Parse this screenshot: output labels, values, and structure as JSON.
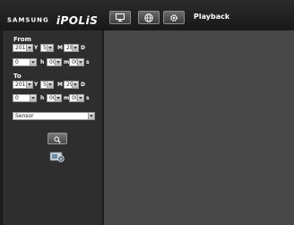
{
  "brand": {
    "company": "SAMSUNG",
    "product": "iPOLiS"
  },
  "header": {
    "buttons": [
      {
        "icon": "monitor-icon"
      },
      {
        "icon": "globe-icon"
      },
      {
        "icon": "gear-icon"
      }
    ],
    "tab_title": "Playback"
  },
  "from": {
    "label": "From",
    "year": "2010",
    "year_unit": "Y",
    "month": "5",
    "month_unit": "M",
    "day": "28",
    "day_unit": "D",
    "hour": "0",
    "hour_unit": "h",
    "minute": "00",
    "minute_unit": "m",
    "second": "00",
    "second_unit": "s"
  },
  "to": {
    "label": "To",
    "year": "2010",
    "year_unit": "Y",
    "month": "5",
    "month_unit": "M",
    "day": "29",
    "day_unit": "D",
    "hour": "0",
    "hour_unit": "h",
    "minute": "00",
    "minute_unit": "m",
    "second": "00",
    "second_unit": "s"
  },
  "event_type": {
    "value": "Sensor"
  },
  "colors": {
    "header": "#1e1e1e",
    "panel": "#2e2e2e",
    "main": "#474747",
    "text": "#ffffff"
  }
}
